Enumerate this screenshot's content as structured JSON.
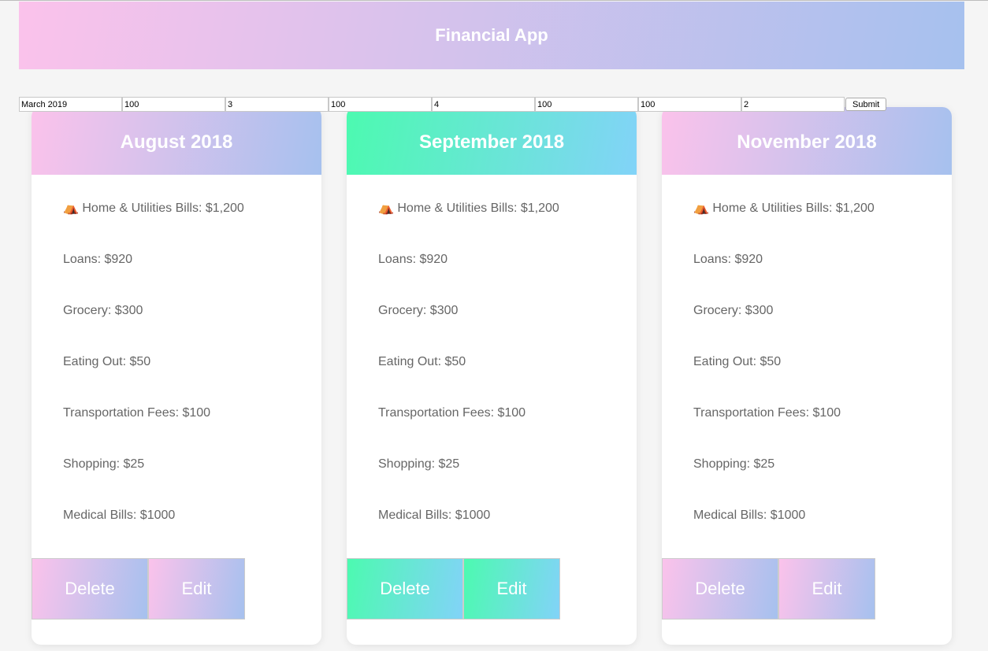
{
  "header": {
    "title": "Financial App"
  },
  "form": {
    "fields": [
      "March 2019",
      "100",
      "3",
      "100",
      "4",
      "100",
      "100",
      "2"
    ],
    "submit_label": "Submit"
  },
  "cards": [
    {
      "month": "August 2018",
      "items": [
        "⛺ Home & Utilities Bills: $1,200",
        "Loans: $920",
        "Grocery: $300",
        "Eating Out: $50",
        "Transportation Fees: $100",
        "Shopping: $25",
        "Medical Bills: $1000"
      ],
      "delete_label": "Delete",
      "edit_label": "Edit"
    },
    {
      "month": "September 2018",
      "items": [
        "⛺ Home & Utilities Bills: $1,200",
        "Loans: $920",
        "Grocery: $300",
        "Eating Out: $50",
        "Transportation Fees: $100",
        "Shopping: $25",
        "Medical Bills: $1000"
      ],
      "delete_label": "Delete",
      "edit_label": "Edit"
    },
    {
      "month": "November 2018",
      "items": [
        "⛺ Home & Utilities Bills: $1,200",
        "Loans: $920",
        "Grocery: $300",
        "Eating Out: $50",
        "Transportation Fees: $100",
        "Shopping: $25",
        "Medical Bills: $1000"
      ],
      "delete_label": "Delete",
      "edit_label": "Edit"
    }
  ]
}
